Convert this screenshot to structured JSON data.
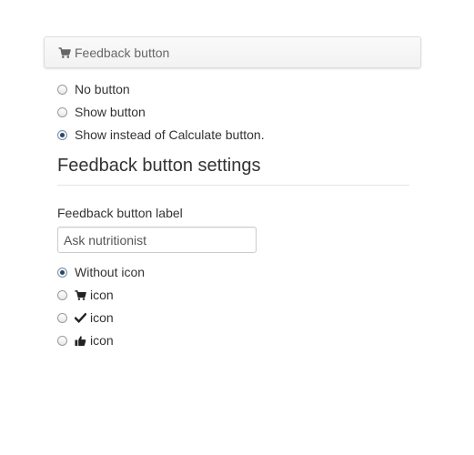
{
  "panel": {
    "title": "Feedback button",
    "icon": "cart-icon"
  },
  "display_options": [
    {
      "label": "No button",
      "checked": false
    },
    {
      "label": "Show button",
      "checked": false
    },
    {
      "label": "Show instead of Calculate button.",
      "checked": true
    }
  ],
  "settings": {
    "title": "Feedback button settings",
    "label_field": {
      "label": "Feedback button label",
      "value": "Ask nutritionist"
    }
  },
  "icon_options": [
    {
      "label": "Without icon",
      "icon": null,
      "checked": true
    },
    {
      "label": "icon",
      "icon": "cart-icon",
      "checked": false
    },
    {
      "label": "icon",
      "icon": "checkmark-icon",
      "checked": false
    },
    {
      "label": "icon",
      "icon": "thumbs-up-icon",
      "checked": false
    }
  ],
  "colors": {
    "radio_selected": "#26476e",
    "text": "#333333",
    "panel_text": "#666666"
  }
}
